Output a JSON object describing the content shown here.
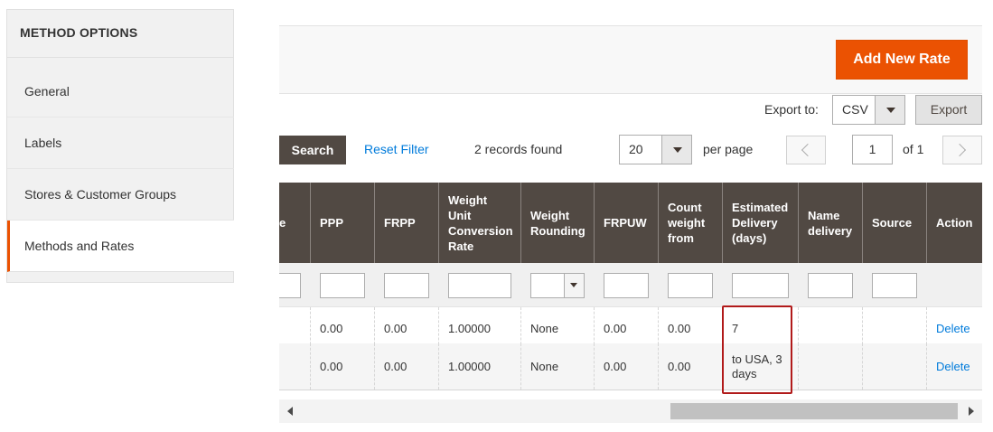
{
  "sidebar": {
    "title": "METHOD OPTIONS",
    "items": [
      {
        "label": "General"
      },
      {
        "label": "Labels"
      },
      {
        "label": "Stores & Customer Groups"
      },
      {
        "label": "Methods and Rates"
      }
    ],
    "active_item": "Methods and Rates"
  },
  "toolbar": {
    "add_new_rate_label": "Add New Rate",
    "export_to_label": "Export to:",
    "export_format": "CSV",
    "export_button_label": "Export",
    "search_button_label": "Search",
    "reset_filter_label": "Reset Filter",
    "records_found": "2 records found",
    "page_size": "20",
    "per_page_label": "per page",
    "current_page": "1",
    "of_pages": "of 1"
  },
  "grid": {
    "columns": [
      {
        "label": "e"
      },
      {
        "label": "PPP"
      },
      {
        "label": "FRPP"
      },
      {
        "label": "Weight\nUnit\nConversion\nRate"
      },
      {
        "label": "Weight\nRounding"
      },
      {
        "label": "FRPUW"
      },
      {
        "label": "Count\nweight\nfrom"
      },
      {
        "label": "Estimated\nDelivery\n(days)"
      },
      {
        "label": "Name\ndelivery"
      },
      {
        "label": "Source"
      },
      {
        "label": "Action"
      }
    ],
    "rows": [
      {
        "ppp": "0.00",
        "frpp": "0.00",
        "conversion": "1.00000",
        "rounding": "None",
        "frpuw": "0.00",
        "count_from": "0.00",
        "estimated": "7",
        "name_delivery": "",
        "source": "",
        "action": "Delete"
      },
      {
        "ppp": "0.00",
        "frpp": "0.00",
        "conversion": "1.00000",
        "rounding": "None",
        "frpuw": "0.00",
        "count_from": "0.00",
        "estimated": "to USA, 3 days",
        "name_delivery": "",
        "source": "",
        "action": "Delete"
      }
    ]
  },
  "colors": {
    "accent": "#eb5202",
    "header_bg": "#514943",
    "link": "#007bdb",
    "highlight": "#b11a1a"
  }
}
